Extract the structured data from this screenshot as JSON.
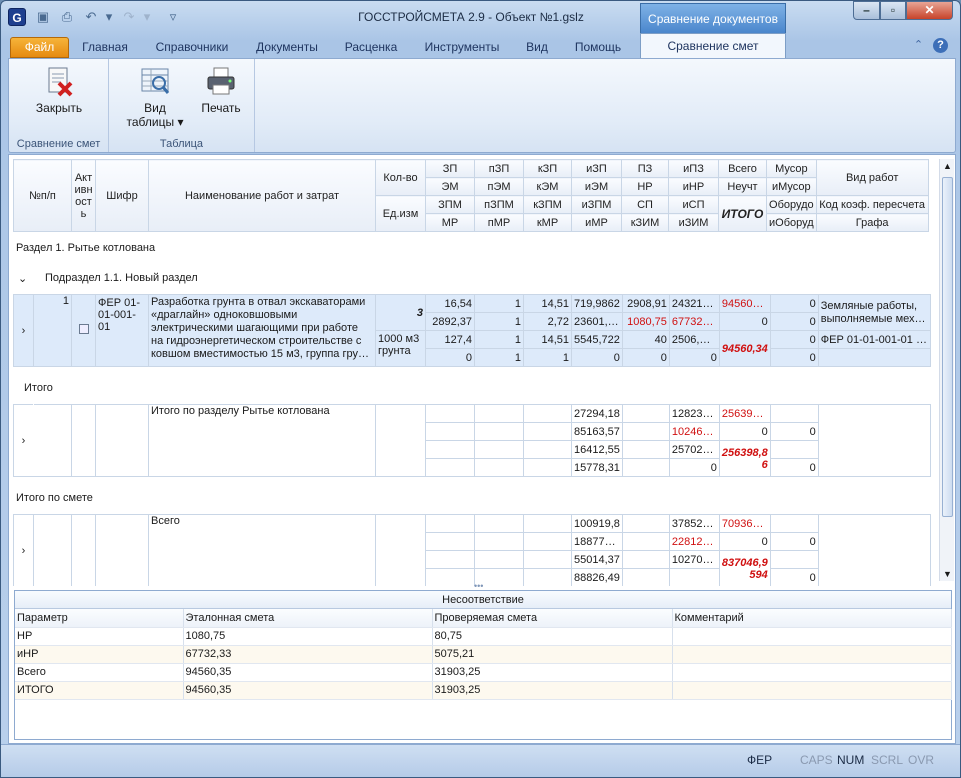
{
  "window": {
    "title": "ГОССТРОЙСМЕТА 2.9 - Объект №1.gslz",
    "context_header": "Сравнение документов"
  },
  "tabs": [
    {
      "label": "Файл"
    },
    {
      "label": "Главная"
    },
    {
      "label": "Справочники"
    },
    {
      "label": "Документы"
    },
    {
      "label": "Расценка"
    },
    {
      "label": "Инструменты"
    },
    {
      "label": "Вид"
    },
    {
      "label": "Помощь"
    },
    {
      "label": "Сравнение смет"
    }
  ],
  "ribbon": {
    "close_label": "Закрыть",
    "group1_label": "Сравнение смет",
    "view_label": "Вид",
    "view_label2": "таблицы",
    "print_label": "Печать",
    "group2_label": "Таблица"
  },
  "header": {
    "num": "№п/п",
    "active": "Акт ивн ост ь",
    "code": "Шифр",
    "name": "Наименование работ и затрат",
    "qty": "Кол-во",
    "unit": "Ед.изм",
    "c1": [
      "ЗП",
      "ЭМ",
      "ЗПМ",
      "МР"
    ],
    "c2": [
      "пЗП",
      "пЭМ",
      "пЗПМ",
      "пМР"
    ],
    "c3": [
      "кЗП",
      "кЭМ",
      "кЗПМ",
      "кМР"
    ],
    "c4": [
      "иЗП",
      "иЭМ",
      "иЗПМ",
      "иМР"
    ],
    "c5": [
      "ПЗ",
      "НР",
      "СП",
      "кЗИМ"
    ],
    "c6": [
      "иПЗ",
      "иНР",
      "иСП",
      "иЗИМ"
    ],
    "c7": [
      "Всего",
      "Неучт",
      "ИТОГО"
    ],
    "c8": [
      "Мусор",
      "иМусор",
      "Оборудо",
      "иОборуд"
    ],
    "c9": [
      "Вид работ",
      "Код коэф. пересчета",
      "Графа"
    ]
  },
  "sections": {
    "razdel": "Раздел 1. Рытье котлована",
    "podrazdel": "Подраздел 1.1. Новый раздел",
    "itogo": "Итого",
    "itogo_smeta": "Итого по смете"
  },
  "row1": {
    "num": "1",
    "code": "ФЕР 01-01-001-01",
    "name": "Разработка грунта в отвал экскаваторами «драглайн» одноковшовыми электрическими шагающими при работе на гидроэнергетическом строительстве с ковшом вместимостью 15 м3, группа гру…",
    "qty": "3",
    "unit": "1000 м3 грунта",
    "c1": [
      "16,54",
      "2892,37",
      "127,4",
      "0"
    ],
    "c2": [
      "1",
      "1",
      "1",
      "1"
    ],
    "c3": [
      "14,51",
      "2,72",
      "14,51",
      "1"
    ],
    "c4": [
      "719,9862",
      "23601,…",
      "5545,722",
      "0"
    ],
    "c5": [
      "2908,91",
      "1080,75",
      "40",
      "0"
    ],
    "c6": [
      "24321…",
      "67732…",
      "2506,…",
      "0"
    ],
    "c7a": "94560…",
    "c7b": "0",
    "c7c": "94560,34",
    "c8": [
      "0",
      "0",
      "0",
      "0"
    ],
    "c9a": "Земляные работы, выполняемые мех…",
    "c9b": "ФЕР 01-01-001-01 …"
  },
  "itogo_razdel": {
    "name": "Итого по разделу Рытье котлована",
    "c4": [
      "27294,18",
      "85163,57",
      "16412,55",
      "15778,31"
    ],
    "c6": [
      "12823…",
      "10246…",
      "25702…",
      "0"
    ],
    "c7a": "25639…",
    "c7b": "0",
    "c7c": "256398,8 6",
    "c8": [
      "0",
      "0"
    ]
  },
  "vsego": {
    "name": "Всего",
    "c4": [
      "100919,8",
      "18877…",
      "55014,37",
      "88826,49"
    ],
    "c6": [
      "37852…",
      "22812…",
      "10270…",
      ""
    ],
    "c7a": "70936…",
    "c7b": "0",
    "c7c": "837046,9 594",
    "c8": [
      "0",
      "0"
    ]
  },
  "mismatch": {
    "caption": "Несоответствие",
    "columns": [
      "Параметр",
      "Эталонная смета",
      "Проверяемая смета",
      "Комментарий"
    ],
    "rows": [
      [
        "НР",
        "1080,75",
        "80,75",
        ""
      ],
      [
        "иНР",
        "67732,33",
        "5075,21",
        ""
      ],
      [
        "Всего",
        "94560,35",
        "31903,25",
        ""
      ],
      [
        "ИТОГО",
        "94560,35",
        "31903,25",
        ""
      ]
    ]
  },
  "status": {
    "fer": "ФЕР",
    "caps": "CAPS",
    "num": "NUM",
    "scrl": "SCRL",
    "ovr": "OVR"
  },
  "colors": {
    "accent": "#e68a10",
    "red": "#d01010",
    "selected": "#ddeafa"
  }
}
